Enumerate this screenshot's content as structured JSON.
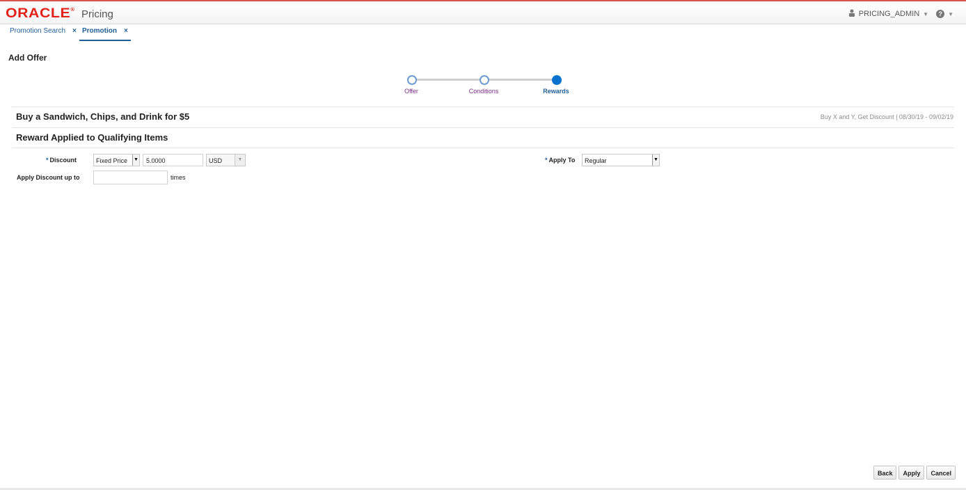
{
  "header": {
    "brand": "ORACLE",
    "brand_mark": "®",
    "app": "Pricing",
    "user": "PRICING_ADMIN"
  },
  "tabs": [
    {
      "label": "Promotion Search"
    },
    {
      "label": "Promotion"
    }
  ],
  "page": {
    "title": "Add Offer"
  },
  "train": [
    {
      "label": "Offer"
    },
    {
      "label": "Conditions"
    },
    {
      "label": "Rewards"
    }
  ],
  "offer": {
    "name": "Buy a Sandwich, Chips, and Drink for $5",
    "meta": "Buy X and Y, Get Discount  |  08/30/19  -  09/02/19"
  },
  "reward": {
    "section_title": "Reward Applied to Qualifying Items",
    "discount_label": "Discount",
    "discount_type": "Fixed Price",
    "discount_value": "5.0000",
    "currency": "USD",
    "apply_to_label": "Apply To",
    "apply_to_value": "Regular",
    "apply_up_to_label": "Apply Discount up to",
    "apply_up_to_value": "",
    "times_label": "times"
  },
  "buttons": {
    "back": "Back",
    "apply": "Apply",
    "cancel": "Cancel"
  },
  "colors": {
    "accent": "#1f5f98",
    "brand": "#e2231a",
    "train_current": "#0572ce"
  }
}
